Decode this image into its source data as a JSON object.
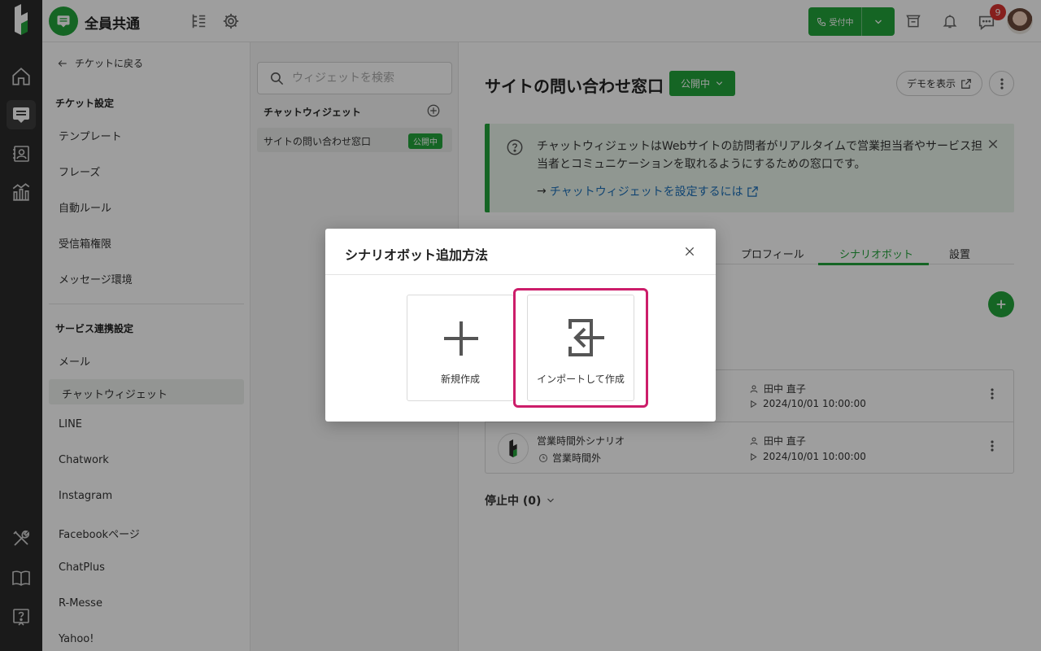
{
  "topbar": {
    "workspace_name": "全員共通",
    "status_label": "受付中",
    "notification_count": "9"
  },
  "settings_sidebar": {
    "back_label": "チケットに戻る",
    "ticket_settings_heading": "チケット設定",
    "ticket_items": [
      "テンプレート",
      "フレーズ",
      "自動ルール",
      "受信箱権限",
      "メッセージ環境"
    ],
    "service_heading": "サービス連携設定",
    "service_items": [
      "メール",
      "チャットウィジェット",
      "LINE",
      "Chatwork",
      "Instagram",
      "Facebookページ",
      "ChatPlus",
      "R-Messe",
      "Yahoo!"
    ],
    "selected_item": "チャットウィジェット"
  },
  "widget_list": {
    "search_placeholder": "ウィジェットを検索",
    "heading": "チャットウィジェット",
    "items": [
      {
        "name": "サイトの問い合わせ窓口",
        "badge": "公開中"
      }
    ]
  },
  "main": {
    "title": "サイトの問い合わせ窓口",
    "publish_status": "公開中",
    "demo_button": "デモを表示",
    "info_text": "チャットウィジェットはWebサイトの訪問者がリアルタイムで営業担当者やサービス担当者とコミュニケーションを取れるようにするための窓口です。",
    "info_link": "チャットウィジェットを設定するには",
    "tabs": [
      "プロフィール",
      "シナリオボット",
      "設置"
    ],
    "active_tab": "シナリオボット",
    "scenarios": [
      {
        "name": "",
        "schedule": "",
        "owner": "田中 直子",
        "date": "2024/10/01 10:00:00"
      },
      {
        "name": "営業時間外シナリオ",
        "schedule": "営業時間外",
        "owner": "田中 直子",
        "date": "2024/10/01 10:00:00"
      }
    ],
    "stopped_label": "停止中 (0)"
  },
  "modal": {
    "title": "シナリオボット追加方法",
    "options": [
      {
        "label": "新規作成",
        "icon": "plus-icon"
      },
      {
        "label": "インポートして作成",
        "icon": "import-icon"
      }
    ],
    "highlighted_option": "インポートして作成"
  },
  "colors": {
    "brand_green": "#22a33a",
    "highlight": "#cc1d6a",
    "rail": "#2b2b2b"
  }
}
